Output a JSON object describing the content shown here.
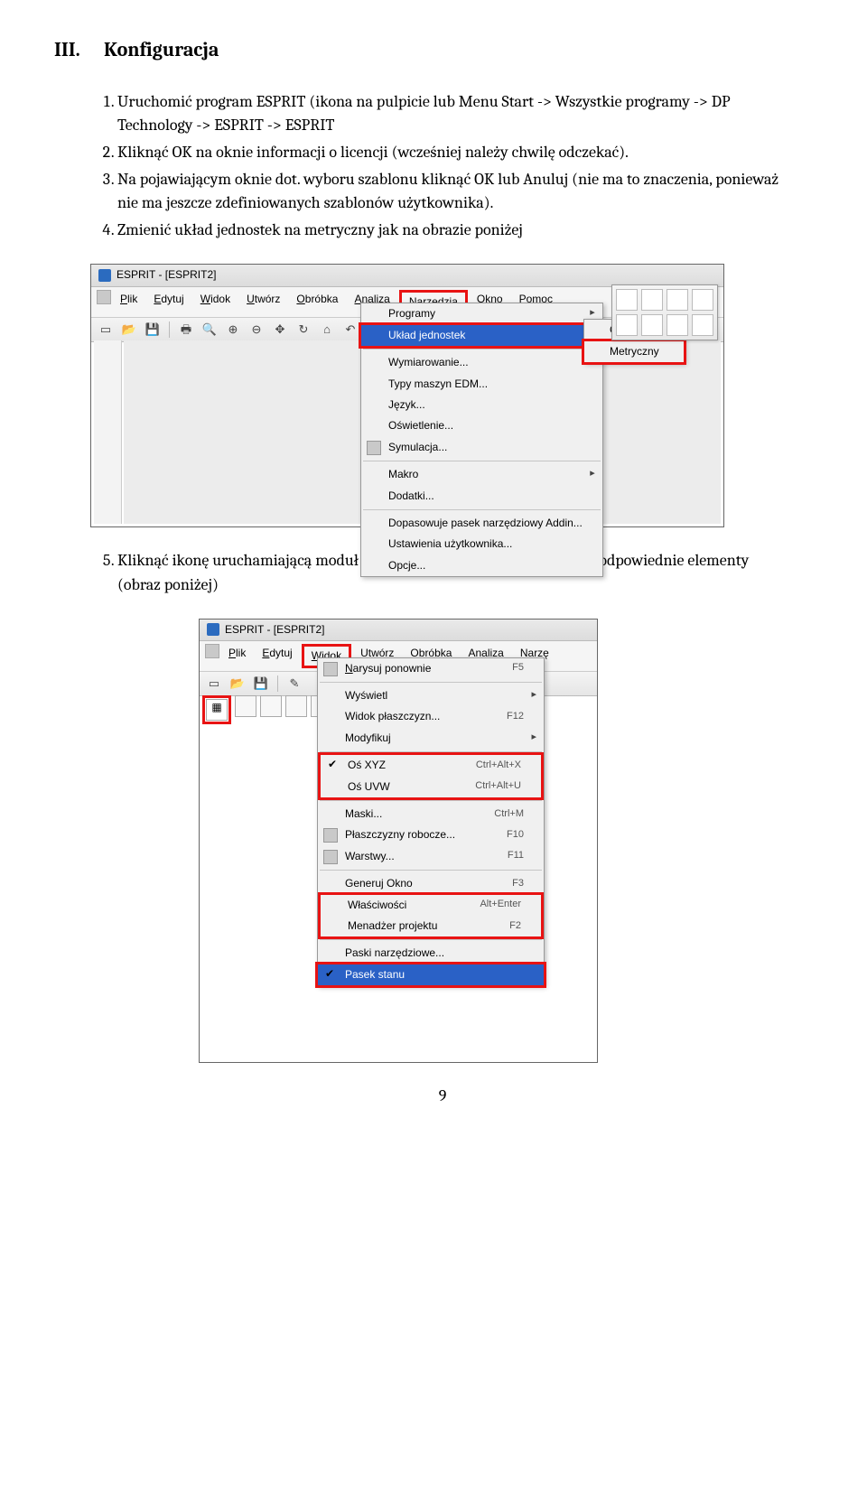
{
  "heading": {
    "roman": "III.",
    "title": "Konfiguracja"
  },
  "list": {
    "item1": "Uruchomić program ESPRIT (ikona na pulpicie lub Menu Start -> Wszystkie programy -> DP Technology -> ESPRIT -> ESPRIT",
    "item2": "Kliknąć OK na oknie informacji o licencji (wcześniej należy chwilę odczekać).",
    "item3": "Na pojawiającym oknie dot. wyboru szablonu kliknąć OK lub Anuluj (nie ma to znaczenia, ponieważ nie ma jeszcze zdefiniowanych szablonów użytkownika).",
    "item4": "Zmienić układ jednostek na metryczny jak na obrazie poniżej",
    "item5": "Kliknąć ikonę uruchamiającą moduł frezarski, a w menu Widok włączyć odpowiednie elementy (obraz poniżej)"
  },
  "shot1": {
    "title": "ESPRIT - [ESPRIT2]",
    "menus": {
      "plik": "Plik",
      "edytuj": "Edytuj",
      "widok": "Widok",
      "utworz": "Utwórz",
      "obrobka": "Obróbka",
      "analiza": "Analiza",
      "narzedzia": "Narzędzia",
      "okno": "Okno",
      "pomoc": "Pomoc"
    },
    "drop": {
      "programy": "Programy",
      "uklad": "Układ jednostek",
      "wymiar": "Wymiarowanie...",
      "typy": "Typy maszyn EDM...",
      "jezyk": "Język...",
      "osw": "Oświetlenie...",
      "sym": "Symulacja...",
      "makro": "Makro",
      "dodatki": "Dodatki...",
      "dopas": "Dopasowuje pasek narzędziowy Addin...",
      "ustaw": "Ustawienia użytkownika...",
      "opcje": "Opcje..."
    },
    "submenu": {
      "calowy": "Calowy",
      "metryczny": "Metryczny"
    }
  },
  "shot2": {
    "title": "ESPRIT - [ESPRIT2]",
    "menus": {
      "plik": "Plik",
      "edytuj": "Edytuj",
      "widok": "Widok",
      "utworz": "Utwórz",
      "obrobka": "Obróbka",
      "analiza": "Analiza",
      "narze": "Narzę"
    },
    "drop": {
      "narysuj": "Narysuj ponownie",
      "wyswietl": "Wyświetl",
      "wplaszcz": "Widok płaszczyzn...",
      "modyfikuj": "Modyfikuj",
      "osxyz": "Oś XYZ",
      "osuvw": "Oś UVW",
      "maski": "Maski...",
      "plaszcz": "Płaszczyzny robocze...",
      "warstwy": "Warstwy...",
      "gen": "Generuj Okno",
      "wlasc": "Właściwości",
      "menadzer": "Menadżer projektu",
      "paski": "Paski narzędziowe...",
      "pasek": "Pasek stanu"
    },
    "keys": {
      "f5": "F5",
      "f12": "F12",
      "caX": "Ctrl+Alt+X",
      "caU": "Ctrl+Alt+U",
      "cM": "Ctrl+M",
      "f10": "F10",
      "f11": "F11",
      "f3": "F3",
      "altE": "Alt+Enter",
      "f2": "F2"
    }
  },
  "page_number": "9"
}
